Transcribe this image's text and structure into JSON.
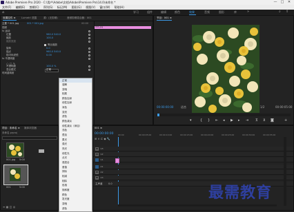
{
  "window": {
    "title": "Adobe Premiere Pro 2020 - C:\\用户\\Adobe\\文档\\Adobe\\Premiere Pro\\14.0\\未命名 *",
    "controls": [
      "—",
      "□",
      "✕"
    ]
  },
  "menubar": [
    "文件(F)",
    "编辑(E)",
    "剪辑(C)",
    "序列(S)",
    "标记(M)",
    "图形(G)",
    "视图(V)",
    "窗口(W)",
    "帮助(H)"
  ],
  "workspaces": [
    "学习",
    "组件",
    "编辑",
    "颜色",
    "效果",
    "音频",
    "图形",
    "库"
  ],
  "active_workspace": "效果",
  "effect_controls": {
    "tabs": [
      "效果控件 ≡",
      "Lumetri 范围",
      "源：(无剪辑)",
      "音频剪辑混合器：001"
    ],
    "source_line": "主要 * 001.jpg",
    "clip_path": "001 * 001.jpg",
    "timecode_left": "00:00",
    "clip_label": "001.jpg",
    "rows": [
      {
        "label": "视频",
        "value": ""
      },
      {
        "label": "fx 运动",
        "value": ""
      },
      {
        "label": "位置",
        "value": "960.0   540.0"
      },
      {
        "label": "缩放",
        "value": "100.0"
      },
      {
        "label": "缩放宽度",
        "value": ""
      },
      {
        "label": "",
        "value": "等比缩放"
      },
      {
        "label": "旋转",
        "value": "0.0"
      },
      {
        "label": "锚点",
        "value": "960.0   540.0"
      },
      {
        "label": "防闪烁滤镜",
        "value": "0.00"
      },
      {
        "label": "fx 不透明度",
        "value": ""
      },
      {
        "label": "",
        "value": ""
      },
      {
        "label": "不透明度",
        "value": "100.0 %"
      },
      {
        "label": "混合模式",
        "value": "正常"
      },
      {
        "label": "时间重映射",
        "value": ""
      }
    ]
  },
  "blend_menu": {
    "items": [
      "正常",
      "溶解",
      "变暗",
      "相乘",
      "颜色加深",
      "线性加深",
      "深色",
      "变亮",
      "滤色",
      "颜色减淡",
      "线性减淡（添加）",
      "浅色",
      "叠加",
      "柔光",
      "强光",
      "亮光",
      "线性光",
      "点光",
      "强混合",
      "差值",
      "排除",
      "相减",
      "相除",
      "色相",
      "饱和度",
      "颜色",
      "发光度",
      "变暗",
      "滤色"
    ],
    "highlighted": "正常"
  },
  "program_monitor": {
    "tab": "节目：001 ≡",
    "timecode": "00:00:00:00",
    "fit": "适合",
    "fraction": "1/2",
    "duration": "00:00:05:00"
  },
  "project": {
    "tabs": [
      "项目：未命名 ≡",
      "媒体浏览器"
    ],
    "file": "未命名.prproj",
    "items": [
      {
        "name": "001.jpg",
        "duration": "5:00"
      },
      {
        "name": "001",
        "duration": "5:00"
      }
    ]
  },
  "timeline": {
    "tab": "001 ≡",
    "timecode": "00:00:00:00",
    "ruler": [
      "00:00",
      "00:00:05:00",
      "00:00:10:00",
      "00:00:15:00",
      "00:00:20:00",
      "00:00:25:00",
      "00:00:30:00",
      "00:00:35:00"
    ],
    "tracks": [
      "V3",
      "V2",
      "V1",
      "A1",
      "A2",
      "A3",
      "主声道"
    ],
    "master_value": "0.0"
  },
  "watermark": "最需教育",
  "colors": {
    "accent": "#3b9ae8",
    "clip_pink": "#e88ee0",
    "menu_bg": "#f2f2f2",
    "watermark_blue": "#2e3f9e"
  }
}
